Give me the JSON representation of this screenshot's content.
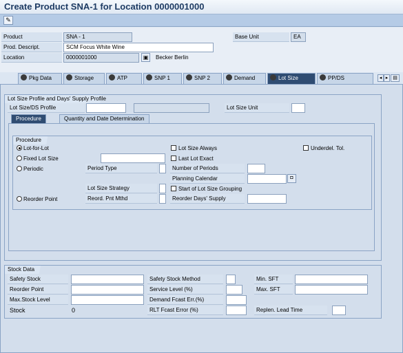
{
  "title": "Create Product SNA-1 for Location 0000001000",
  "toolbar": {
    "first_button_icon": "edit-icon"
  },
  "header": {
    "product_label": "Product",
    "product_value": "SNA - 1",
    "descr_label": "Prod. Descript.",
    "descr_value": "SCM Focus White Wine",
    "location_label": "Location",
    "location_value": "0000001000",
    "location_name": "Becker Berlin",
    "base_unit_label": "Base Unit",
    "base_unit_value": "EA"
  },
  "tabs": [
    {
      "label": "Pkg Data",
      "active": false
    },
    {
      "label": "Storage",
      "active": false
    },
    {
      "label": "ATP",
      "active": false
    },
    {
      "label": "SNP 1",
      "active": false
    },
    {
      "label": "SNP 2",
      "active": false
    },
    {
      "label": "Demand",
      "active": false
    },
    {
      "label": "Lot Size",
      "active": true
    },
    {
      "label": "PP/DS",
      "active": false
    }
  ],
  "lot_size": {
    "group_title": "Lot Size Profile and Days' Supply Profile",
    "profile_label": "Lot Size/DS Profile",
    "unit_label": "Lot Size Unit",
    "subtabs": [
      "Procedure",
      "Quantity and Date Determination"
    ],
    "procedure_title": "Procedure",
    "lot_for_lot": "Lot-for-Lot",
    "fixed_lot_size": "Fixed Lot Size",
    "periodic": "Periodic",
    "reorder_point": "Reorder Point",
    "period_type": "Period Type",
    "lot_size_strategy": "Lot Size Strategy",
    "reord_pnt_mthd": "Reord. Pnt Mthd",
    "lot_size_always": "Lot Size Always",
    "last_lot_exact": "Last Lot Exact",
    "number_of_periods": "Number of Periods",
    "planning_calendar": "Planning Calendar",
    "start_of_grouping": "Start of Lot Size Grouping",
    "reorder_days_supply": "Reorder Days' Supply",
    "underdel_tol": "Underdel. Tol."
  },
  "stock": {
    "group_title": "Stock Data",
    "safety_stock": "Safety Stock",
    "reorder_point": "Reorder Point",
    "max_stock_level": "Max.Stock Level",
    "stock_label": "Stock",
    "stock_value": "0",
    "safety_stock_method": "Safety Stock Method",
    "service_level": "Service Level (%)",
    "demand_fcast_err": "Demand Fcast Err.(%)",
    "rlt_fcast_error": "RLT Fcast Error (%)",
    "min_sft": "Min. SFT",
    "max_sft": "Max. SFT",
    "replen_lead_time": "Replen. Lead Time"
  }
}
